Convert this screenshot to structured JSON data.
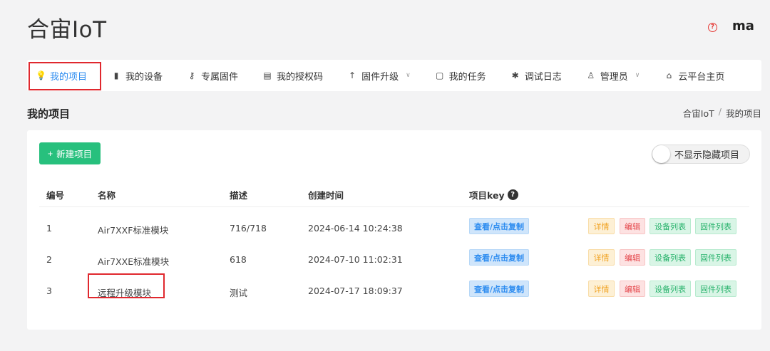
{
  "header": {
    "brand": "合宙IoT",
    "help_icon": "question-circle-icon",
    "username": "ma"
  },
  "nav": {
    "items": [
      {
        "label": "我的项目",
        "icon": "lightbulb-icon",
        "glyph": "💡",
        "active": true,
        "dropdown": false
      },
      {
        "label": "我的设备",
        "icon": "chip-icon",
        "glyph": "▮",
        "active": false,
        "dropdown": false
      },
      {
        "label": "专属固件",
        "icon": "key-icon",
        "glyph": "⚷",
        "active": false,
        "dropdown": false
      },
      {
        "label": "我的授权码",
        "icon": "barcode-icon",
        "glyph": "▤",
        "active": false,
        "dropdown": false
      },
      {
        "label": "固件升级",
        "icon": "arrow-up-icon",
        "glyph": "↑",
        "active": false,
        "dropdown": true
      },
      {
        "label": "我的任务",
        "icon": "calendar-icon",
        "glyph": "▢",
        "active": false,
        "dropdown": false
      },
      {
        "label": "调试日志",
        "icon": "bug-icon",
        "glyph": "✱",
        "active": false,
        "dropdown": false
      },
      {
        "label": "管理员",
        "icon": "user-icon",
        "glyph": "♙",
        "active": false,
        "dropdown": true
      },
      {
        "label": "云平台主页",
        "icon": "home-icon",
        "glyph": "⌂",
        "active": false,
        "dropdown": false
      }
    ],
    "chevron_glyph": "∨"
  },
  "page": {
    "title": "我的项目",
    "breadcrumb": [
      "合宙IoT",
      "我的项目"
    ],
    "breadcrumb_sep": "/"
  },
  "toolbar": {
    "new_label": "新建项目",
    "new_prefix": "+",
    "toggle_label": "不显示隐藏项目"
  },
  "table": {
    "headers": {
      "id": "编号",
      "name": "名称",
      "desc": "描述",
      "created": "创建时间",
      "key": "项目key"
    },
    "key_help_glyph": "?",
    "rows": [
      {
        "id": "1",
        "name": "Air7XXF标准模块",
        "desc": "716/718",
        "created": "2024-06-14 10:24:38",
        "key_label": "查看/点击复制",
        "highlight": false
      },
      {
        "id": "2",
        "name": "Air7XXE标准模块",
        "desc": "618",
        "created": "2024-07-10 11:02:31",
        "key_label": "查看/点击复制",
        "highlight": false
      },
      {
        "id": "3",
        "name": "远程升级模块",
        "desc": "测试",
        "created": "2024-07-17 18:09:37",
        "key_label": "查看/点击复制",
        "highlight": true
      }
    ],
    "actions": {
      "detail": "详情",
      "edit": "编辑",
      "devices": "设备列表",
      "firmware": "固件列表"
    }
  },
  "colors": {
    "primary": "#2d8cf0",
    "success": "#27c07d",
    "highlight_border": "#e0282e"
  }
}
